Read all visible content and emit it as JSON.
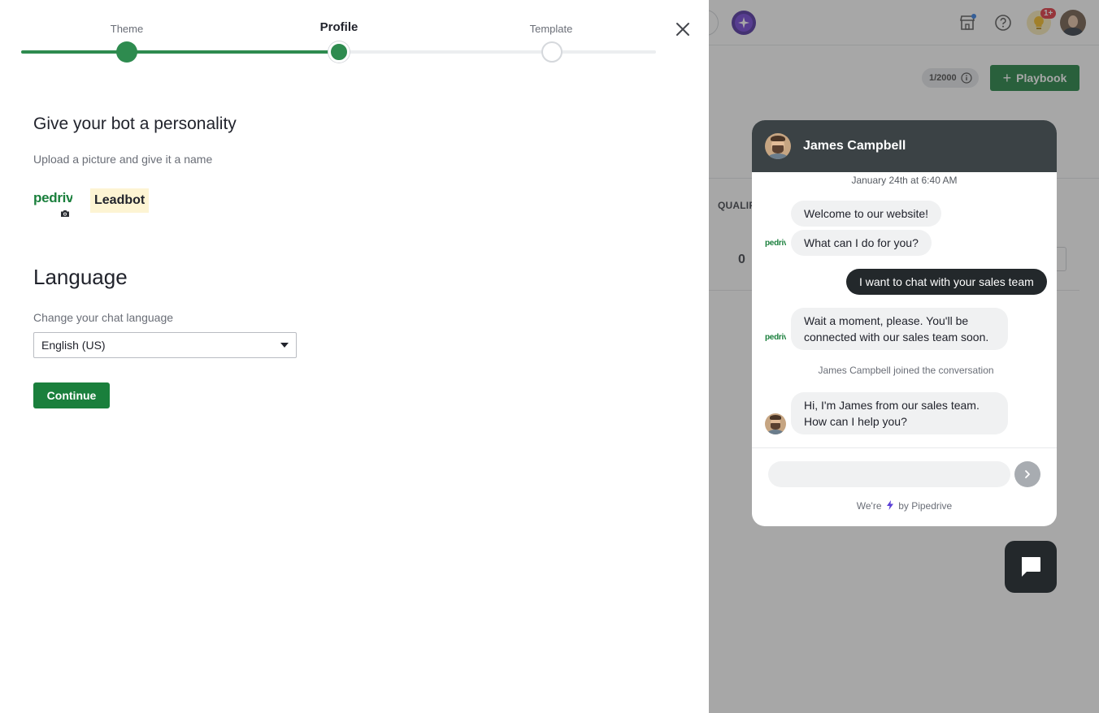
{
  "wizard": {
    "steps": [
      {
        "label": "Theme",
        "state": "done"
      },
      {
        "label": "Profile",
        "state": "current"
      },
      {
        "label": "Template",
        "state": "todo"
      }
    ],
    "close_icon": "close-icon"
  },
  "profile": {
    "title": "Give your bot a personality",
    "subtitle": "Upload a picture and give it a name",
    "logo_text": "pedriv",
    "bot_name": "Leadbot",
    "camera_icon": "camera-icon"
  },
  "language": {
    "title": "Language",
    "label": "Change your chat language",
    "selected": "English (US)"
  },
  "actions": {
    "continue_label": "Continue"
  },
  "background_app": {
    "counter": "1/2000",
    "playbook_label": "Playbook",
    "column_header": "QUALIF",
    "count_value": "0",
    "notification_badge": "1+"
  },
  "chat_preview": {
    "agent_name": "James Campbell",
    "date": "January 24th at 6:40 AM",
    "bot_logo_text": "pedriv",
    "messages": [
      {
        "from": "bot",
        "text": "Welcome to our website!"
      },
      {
        "from": "bot",
        "text": "What can I do for you?"
      },
      {
        "from": "user",
        "text": "I want to chat with your sales team"
      },
      {
        "from": "bot",
        "text": "Wait a moment, please. You'll be connected with our sales team soon."
      },
      {
        "from": "agent",
        "text": "Hi, I'm James from our sales team. How can I help you?"
      }
    ],
    "joined_text": "James Campbell joined the conversation",
    "powered_prefix": "We're",
    "powered_suffix": "by Pipedrive"
  },
  "colors": {
    "brand_green": "#1a7f3c",
    "progress_green": "#2e8b4f",
    "chat_header": "#3b4245",
    "user_bubble": "#23282b"
  }
}
